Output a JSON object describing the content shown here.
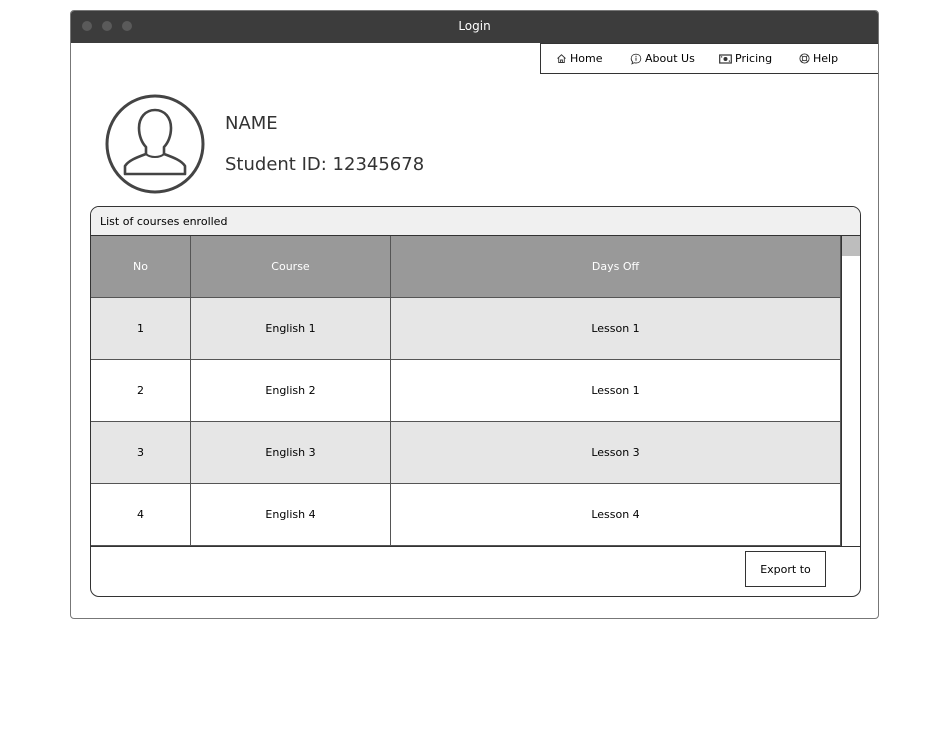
{
  "window": {
    "title": "Login"
  },
  "nav": {
    "items": [
      {
        "label": "Home",
        "icon": "home-icon"
      },
      {
        "label": "About Us",
        "icon": "info-icon"
      },
      {
        "label": "Pricing",
        "icon": "money-icon"
      },
      {
        "label": "Help",
        "icon": "help-icon"
      }
    ]
  },
  "profile": {
    "name": "NAME",
    "student_id": "Student ID: 12345678",
    "avatar_icon": "user-avatar-icon"
  },
  "courses": {
    "title": "List of courses enrolled",
    "columns": [
      "No",
      "Course",
      "Days Off"
    ],
    "rows": [
      [
        "1",
        "English 1",
        "Lesson 1"
      ],
      [
        "2",
        "English 2",
        "Lesson 1"
      ],
      [
        "3",
        "English 3",
        "Lesson 3"
      ],
      [
        "4",
        "English 4",
        "Lesson 4"
      ]
    ]
  },
  "actions": {
    "export_label": "Export to"
  },
  "colors": {
    "titlebar": "#3c3c3c",
    "table_header": "#999999",
    "row_alt": "#e6e6e6",
    "panel_header": "#f0f0f0"
  }
}
